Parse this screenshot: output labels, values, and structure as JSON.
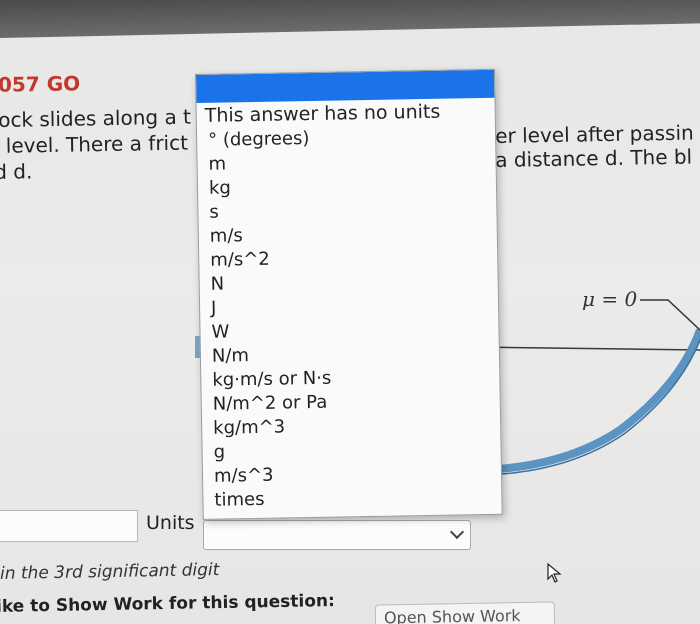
{
  "problem": {
    "id": "057 GO",
    "lines_left": [
      "ock slides along a t",
      "- level. There a frict",
      "d d."
    ],
    "lines_right": [
      "er level after passin",
      "a distance d. The bl"
    ],
    "mu_label": "μ = 0"
  },
  "answer": {
    "units_label": "Units",
    "units_value": "",
    "unit_options": [
      "This answer has no units",
      "° (degrees)",
      "m",
      "kg",
      "s",
      "m/s",
      "m/s^2",
      "N",
      "J",
      "W",
      "N/m",
      "kg·m/s or N·s",
      "N/m^2 or Pa",
      "kg/m^3",
      "g",
      "m/s^3",
      "times"
    ],
    "sigfig_note": "in the 3rd significant digit",
    "show_work_prompt": "ike to Show Work for this question:",
    "show_work_button": "Open Show Work"
  },
  "colors": {
    "accent": "#1a73e8",
    "problem_id": "#c0392b",
    "curve": "#5b93c2"
  },
  "icons": [
    "chevron-down-icon",
    "mouse-cursor-icon"
  ]
}
